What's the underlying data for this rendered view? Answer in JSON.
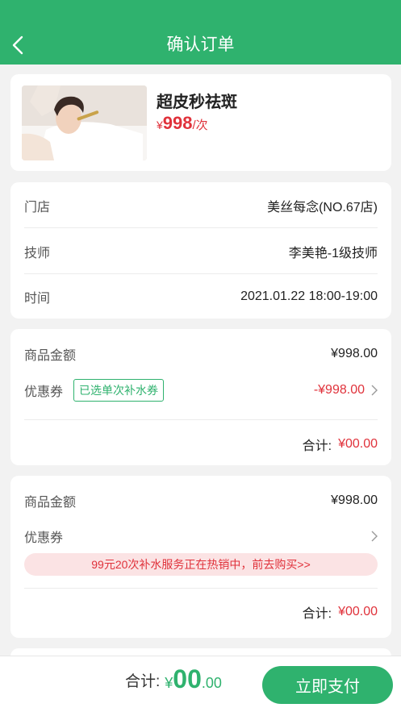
{
  "header": {
    "title": "确认订单"
  },
  "product": {
    "name": "超皮秒祛斑",
    "price_symbol": "¥",
    "price": "998",
    "unit": "/次"
  },
  "info": {
    "rows": [
      {
        "label": "门店",
        "value": "美丝每念(NO.67店)"
      },
      {
        "label": "技师",
        "value": "李美艳-1级技师"
      },
      {
        "label": "时间",
        "value": "2021.01.22 18:00-19:00"
      }
    ]
  },
  "amount_card_1": {
    "goods_label": "商品金额",
    "goods_value": "¥998.00",
    "coupon_label": "优惠券",
    "coupon_tag": "已选单次补水券",
    "coupon_value": "-¥998.00",
    "total_label": "合计:",
    "total_value": "¥00.00"
  },
  "amount_card_2": {
    "goods_label": "商品金额",
    "goods_value": "¥998.00",
    "coupon_label": "优惠券",
    "promo_text": "99元20次补水服务正在热销中，前去购买>>",
    "total_label": "合计:",
    "total_value": "¥00.00"
  },
  "footer": {
    "total_label": "合计:",
    "symbol": "¥",
    "integer": "00",
    "decimal": ".00",
    "pay_button": "立即支付"
  },
  "colors": {
    "accent": "#2fb26e",
    "price": "#e0323b",
    "promo_bg": "#fbe3e4"
  }
}
